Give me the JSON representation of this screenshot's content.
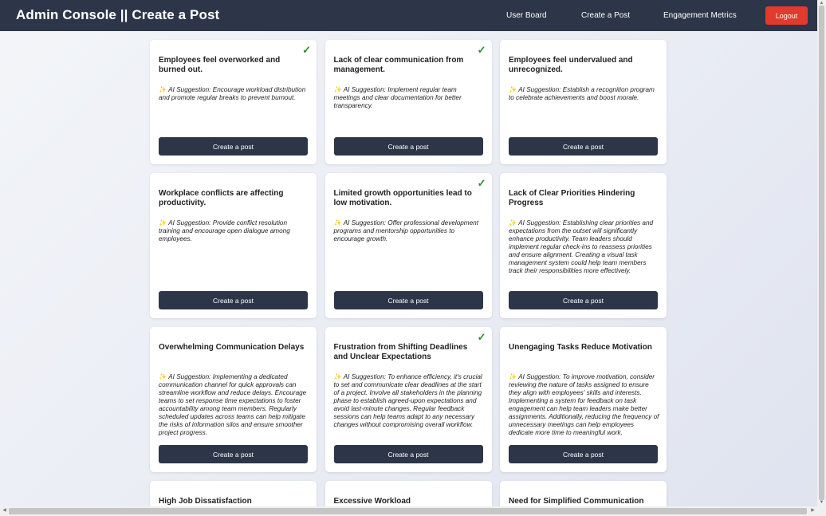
{
  "header": {
    "title": "Admin Console || Create a Post",
    "nav": [
      "User Board",
      "Create a Post",
      "Engagement Metrics"
    ],
    "logout_label": "Logout"
  },
  "icons": {
    "check": "check-icon",
    "sparkle": "sparkle-icon"
  },
  "colors": {
    "header_bg": "#2d3648",
    "logout_bg": "#e23a2c",
    "check": "#2f8a2f",
    "button_bg": "#2d3648"
  },
  "suggestion_prefix": "AI Suggestion:",
  "create_label": "Create a post",
  "cards": [
    {
      "title": "Employees feel overworked and burned out.",
      "checked": true,
      "suggestion": "Encourage workload distribution and promote regular breaks to prevent burnout."
    },
    {
      "title": "Lack of clear communication from management.",
      "checked": true,
      "suggestion": "Implement regular team meetings and clear documentation for better transparency."
    },
    {
      "title": "Employees feel undervalued and unrecognized.",
      "checked": false,
      "suggestion": "Establish a recognition program to celebrate achievements and boost morale."
    },
    {
      "title": "Workplace conflicts are affecting productivity.",
      "checked": false,
      "suggestion": "Provide conflict resolution training and encourage open dialogue among employees."
    },
    {
      "title": "Limited growth opportunities lead to low motivation.",
      "checked": true,
      "suggestion": "Offer professional development programs and mentorship opportunities to encourage growth."
    },
    {
      "title": "Lack of Clear Priorities Hindering Progress",
      "checked": false,
      "suggestion": "Establishing clear priorities and expectations from the outset will significantly enhance productivity. Team leaders should implement regular check-ins to reassess priorities and ensure alignment. Creating a visual task management system could help team members track their responsibilities more effectively."
    },
    {
      "title": "Overwhelming Communication Delays",
      "checked": false,
      "suggestion": "Implementing a dedicated communication channel for quick approvals can streamline workflow and reduce delays. Encourage teams to set response time expectations to foster accountability among team members. Regularly scheduled updates across teams can help mitigate the risks of information silos and ensure smoother project progress."
    },
    {
      "title": "Frustration from Shifting Deadlines and Unclear Expectations",
      "checked": true,
      "suggestion": "To enhance efficiency, it's crucial to set and communicate clear deadlines at the start of a project. Involve all stakeholders in the planning phase to establish agreed-upon expectations and avoid last-minute changes. Regular feedback sessions can help teams adapt to any necessary changes without compromising overall workflow."
    },
    {
      "title": "Unengaging Tasks Reduce Motivation",
      "checked": false,
      "suggestion": "To improve motivation, consider reviewing the nature of tasks assigned to ensure they align with employees' skills and interests. Implementing a system for feedback on task engagement can help team leaders make better assignments. Additionally, reducing the frequency of unnecessary meetings can help employees dedicate more time to meaningful work."
    },
    {
      "title": "High Job Dissatisfaction",
      "checked": false,
      "suggestion": ""
    },
    {
      "title": "Excessive Workload",
      "checked": false,
      "suggestion": ""
    },
    {
      "title": "Need for Simplified Communication",
      "checked": false,
      "suggestion": ""
    }
  ]
}
